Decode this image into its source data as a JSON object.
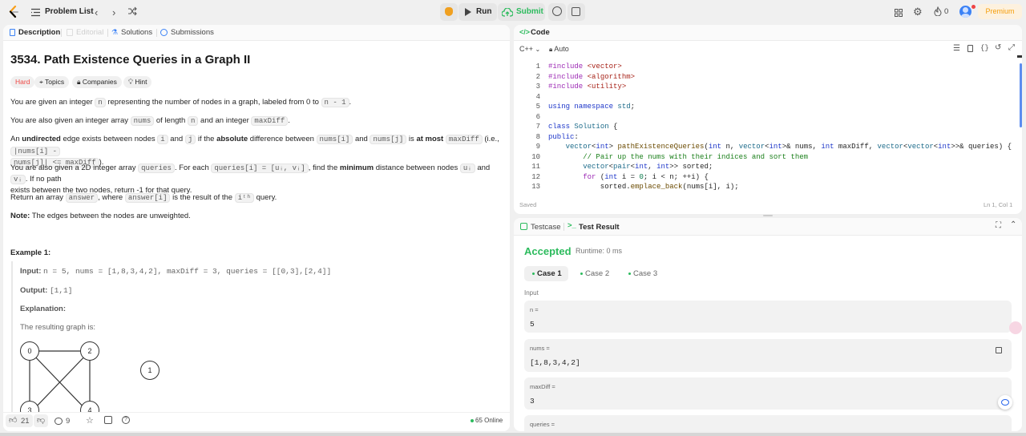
{
  "header": {
    "title": "Problem List",
    "run_label": "Run",
    "submit_label": "Submit",
    "streak": "0",
    "premium_label": "Premium",
    "accent_color": "#f59e0b",
    "submit_color": "#2cbb5d"
  },
  "left_tabs": {
    "description": "Description",
    "editorial": "Editorial",
    "solutions": "Solutions",
    "submissions": "Submissions"
  },
  "problem": {
    "title": "3534. Path Existence Queries in a Graph II",
    "difficulty": "Hard",
    "tags": {
      "topics": "Topics",
      "companies": "Companies",
      "hint": "Hint"
    },
    "p1": {
      "a": "You are given an integer ",
      "c1": "n",
      "b": " representing the number of nodes in a graph, labeled from 0 to ",
      "c2": "n - 1",
      "d": "."
    },
    "p2": {
      "a": "You are also given an integer array ",
      "c1": "nums",
      "b": " of length ",
      "c2": "n",
      "d": " and an integer ",
      "c3": "maxDiff",
      "e": "."
    },
    "p3": {
      "a": "An ",
      "b1": "undirected",
      "b": " edge exists between nodes ",
      "c1": "i",
      "c": " and ",
      "c2": "j",
      "d": " if the ",
      "b2": "absolute",
      "e": " difference between ",
      "c3": "nums[i]",
      "f": " and ",
      "c4": "nums[j]",
      "g": " is ",
      "b3": "at most",
      "h": " ",
      "c5": "maxDiff",
      "i": " (i.e., ",
      "c6": "|nums[i] -",
      "c7": "nums[j]| <= maxDiff",
      "j": ")."
    },
    "p4": {
      "a": "You are also given a 2D integer array ",
      "c1": "queries",
      "b": ". For each ",
      "c2": "queries[i] = [uᵢ, vᵢ]",
      "c": ", find the ",
      "b1": "minimum",
      "d": " distance between nodes ",
      "c3": "uᵢ",
      "e": " and ",
      "c4": "vᵢ",
      "f": ". If no path",
      "g": "exists between the two nodes, return -1 for that query."
    },
    "p5": {
      "a": "Return an array ",
      "c1": "answer",
      "b": ", where ",
      "c2": "answer[i]",
      "c": " is the result of the ",
      "c3": "iᵗʰ",
      "d": " query."
    },
    "note": {
      "label": "Note:",
      "text": " The edges between the nodes are unweighted."
    },
    "example": {
      "title": "Example 1:",
      "input_label": "Input:",
      "input": "n = 5, nums = [1,8,3,4,2], maxDiff = 3, queries = [[0,3],[2,4]]",
      "output_label": "Output:",
      "output": "[1,1]",
      "explanation_label": "Explanation:",
      "graph_caption": "The resulting graph is:",
      "nodes": [
        "0",
        "2",
        "1",
        "3",
        "4"
      ]
    }
  },
  "left_footer": {
    "likes": "21",
    "comments": "9",
    "online": "65 Online"
  },
  "code_panel": {
    "title": "Code",
    "language": "C++",
    "auto": "Auto",
    "saved": "Saved",
    "cursor": "Ln 1, Col 1",
    "line_numbers": [
      "1",
      "2",
      "3",
      "4",
      "5",
      "6",
      "7",
      "8",
      "9",
      "10",
      "11",
      "12",
      "13"
    ]
  },
  "test_panel": {
    "tab_testcase": "Testcase",
    "tab_result": "Test Result",
    "status": "Accepted",
    "runtime": "Runtime: 0 ms",
    "cases": [
      "Case 1",
      "Case 2",
      "Case 3"
    ],
    "input_label": "Input",
    "fields": [
      {
        "label": "n =",
        "value": "5"
      },
      {
        "label": "nums =",
        "value": "[1,8,3,4,2]"
      },
      {
        "label": "maxDiff =",
        "value": "3"
      },
      {
        "label": "queries =",
        "value": ""
      }
    ]
  }
}
